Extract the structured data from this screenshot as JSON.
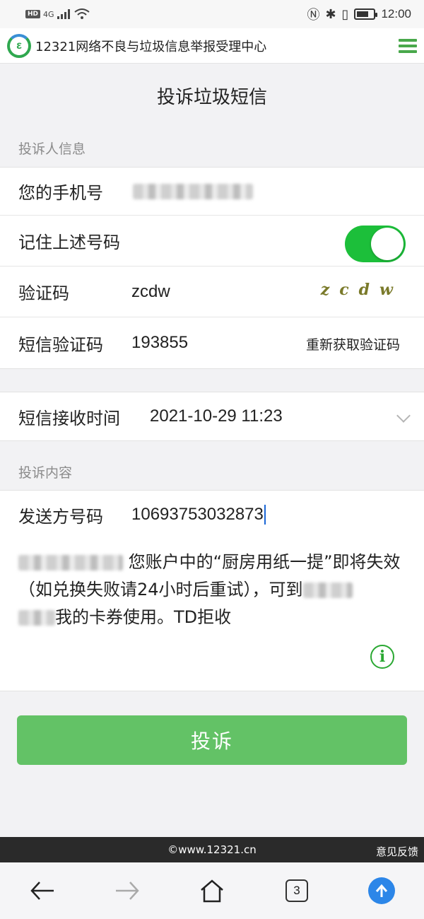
{
  "status_bar": {
    "hd_badge": "HD",
    "network": "4G",
    "time": "12:00"
  },
  "header": {
    "logo_text": "ε",
    "title": "12321网络不良与垃圾信息举报受理中心"
  },
  "page": {
    "title": "投诉垃圾短信"
  },
  "complainant": {
    "section_label": "投诉人信息",
    "phone_label": "您的手机号",
    "remember_label": "记住上述号码",
    "remember_on": true,
    "captcha_label": "验证码",
    "captcha_value": "zcdw",
    "captcha_image_text": "zcdw",
    "sms_code_label": "短信验证码",
    "sms_code_value": "193855",
    "resend_label": "重新获取验证码"
  },
  "receive_time": {
    "label": "短信接收时间",
    "value": "2021-10-29 11:23"
  },
  "content": {
    "section_label": "投诉内容",
    "sender_label": "发送方号码",
    "sender_value": "10693753032873",
    "message_part1": "您账户中的“厨房用纸一提”即将失效（如兑换失败请24小时后重试），可到",
    "message_part2": "我的卡券使用。TD拒收"
  },
  "actions": {
    "submit_label": "投诉"
  },
  "footer": {
    "copyright": "©www.12321.cn",
    "feedback": "意见反馈"
  },
  "browser": {
    "tab_count": "3"
  }
}
